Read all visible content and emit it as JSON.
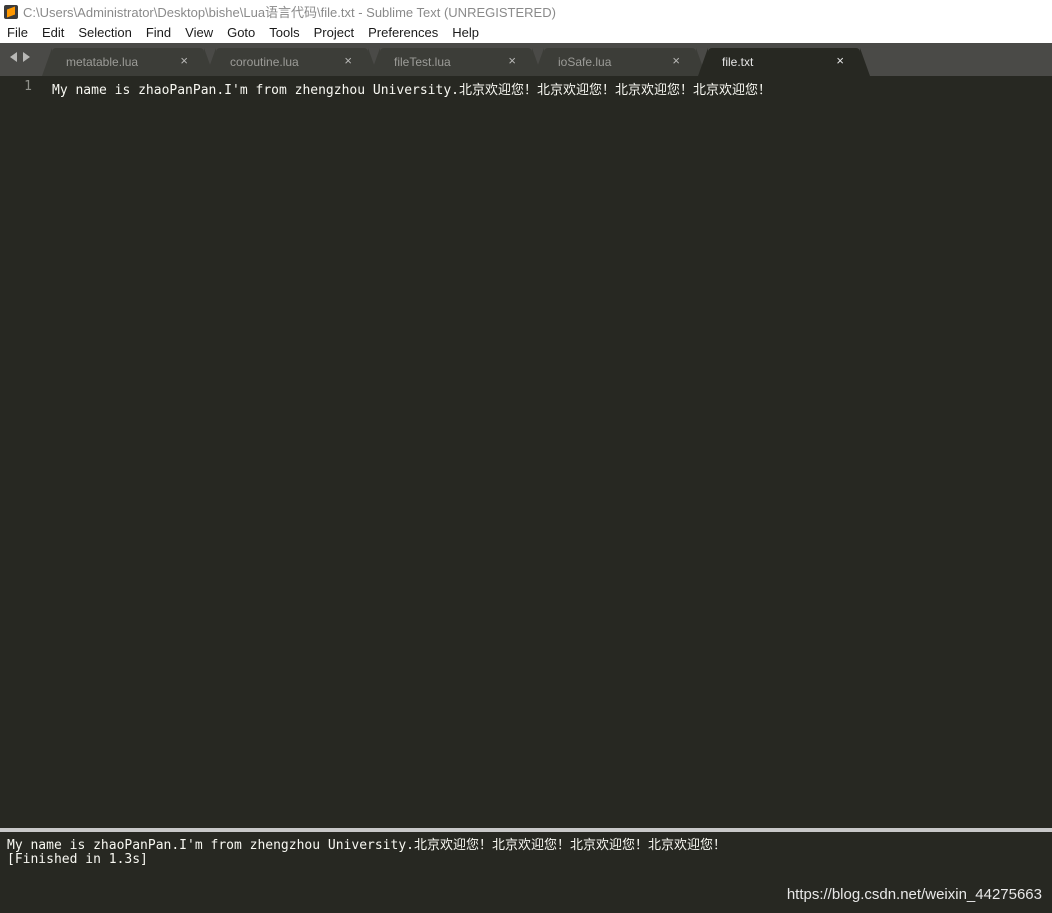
{
  "window": {
    "title": "C:\\Users\\Administrator\\Desktop\\bishe\\Lua语言代码\\file.txt - Sublime Text (UNREGISTERED)",
    "icon": "sublime-text-icon"
  },
  "menu": [
    "File",
    "Edit",
    "Selection",
    "Find",
    "View",
    "Goto",
    "Tools",
    "Project",
    "Preferences",
    "Help"
  ],
  "tabs": [
    {
      "label": "metatable.lua",
      "active": false
    },
    {
      "label": "coroutine.lua",
      "active": false
    },
    {
      "label": "fileTest.lua",
      "active": false
    },
    {
      "label": "ioSafe.lua",
      "active": false
    },
    {
      "label": "file.txt",
      "active": true
    }
  ],
  "tab_close_glyph": "×",
  "editor": {
    "line_numbers": [
      "1"
    ],
    "lines": [
      "My name is zhaoPanPan.I'm from zhengzhou University.北京欢迎您！北京欢迎您！北京欢迎您！北京欢迎您！"
    ]
  },
  "output": {
    "lines": [
      "My name is zhaoPanPan.I'm from zhengzhou University.北京欢迎您！北京欢迎您！北京欢迎您！北京欢迎您！",
      "[Finished in 1.3s]"
    ]
  },
  "watermark": "https://blog.csdn.net/weixin_44275663",
  "colors": {
    "editor_bg": "#272822",
    "tabbar_bg": "#4a4a47",
    "text": "#f8f8f2",
    "gutter": "#8f908a"
  }
}
